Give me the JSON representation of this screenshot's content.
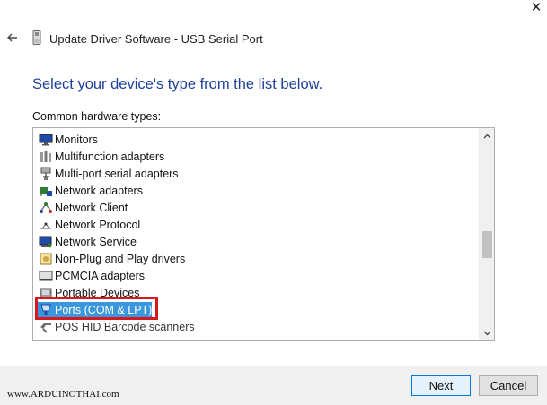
{
  "window": {
    "title": "Update Driver Software - USB Serial Port"
  },
  "heading": "Select your device's type from the list below.",
  "list_caption": "Common hardware types:",
  "hardware_types": [
    {
      "label": "Monitors",
      "icon": "monitor-icon"
    },
    {
      "label": "Multifunction adapters",
      "icon": "multifunction-adapter-icon"
    },
    {
      "label": "Multi-port serial adapters",
      "icon": "multiport-serial-icon"
    },
    {
      "label": "Network adapters",
      "icon": "network-adapter-icon"
    },
    {
      "label": "Network Client",
      "icon": "network-client-icon"
    },
    {
      "label": "Network Protocol",
      "icon": "network-protocol-icon"
    },
    {
      "label": "Network Service",
      "icon": "network-service-icon"
    },
    {
      "label": "Non-Plug and Play drivers",
      "icon": "non-pnp-driver-icon"
    },
    {
      "label": "PCMCIA adapters",
      "icon": "pcmcia-icon"
    },
    {
      "label": "Portable Devices",
      "icon": "portable-device-icon"
    },
    {
      "label": "Ports (COM & LPT)",
      "icon": "port-connector-icon",
      "selected": true
    },
    {
      "label": "POS HID Barcode scanners",
      "icon": "barcode-scanner-icon"
    }
  ],
  "selected_index": 10,
  "buttons": {
    "next": "Next",
    "cancel": "Cancel"
  },
  "watermark": "www.ARDUINOTHAI.com",
  "colors": {
    "heading": "#1e3f9a",
    "selection": "#3a96dd",
    "highlight_box": "#d7191e"
  }
}
